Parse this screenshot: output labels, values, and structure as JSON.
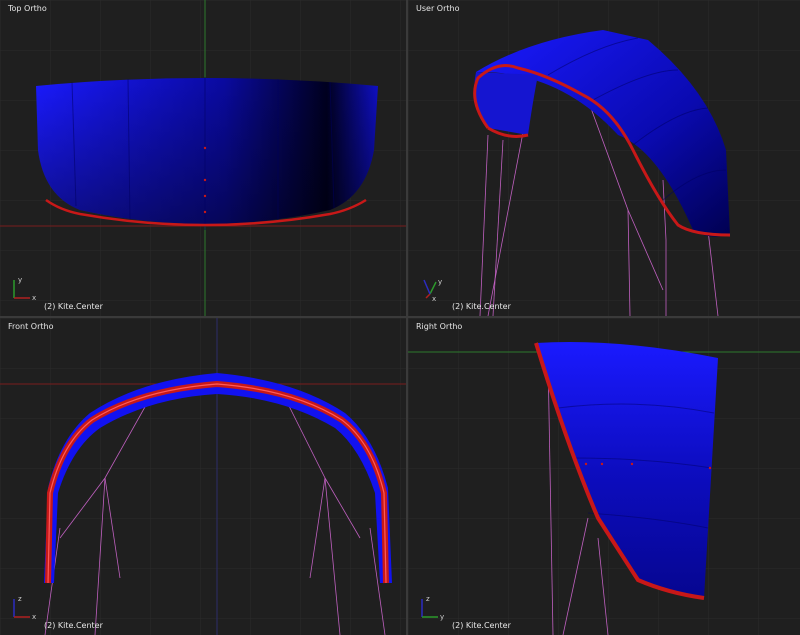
{
  "viewports": {
    "top": {
      "title": "Top Ortho",
      "status": "(2) Kite.Center",
      "axis_labels": {
        "a": "y",
        "b": "x"
      }
    },
    "user": {
      "title": "User Ortho",
      "status": "(2) Kite.Center",
      "axis_labels": {
        "a": "y",
        "b": "x"
      }
    },
    "front": {
      "title": "Front Ortho",
      "status": "(2) Kite.Center",
      "axis_labels": {
        "a": "z",
        "b": "x"
      }
    },
    "right": {
      "title": "Right Ortho",
      "status": "(2) Kite.Center",
      "axis_labels": {
        "a": "z",
        "b": "y"
      }
    }
  },
  "colors": {
    "background": "#1f1f1f",
    "grid": "#2b2b2b",
    "grid_major": "#353535",
    "axis_x": "#7a1c1c",
    "axis_y": "#2c7a2c",
    "kite_canopy": "#1010ee",
    "kite_edge": "#c81818",
    "bridle_lines": "#c060c0"
  },
  "icons": [
    "axis-gizmo-icon"
  ]
}
